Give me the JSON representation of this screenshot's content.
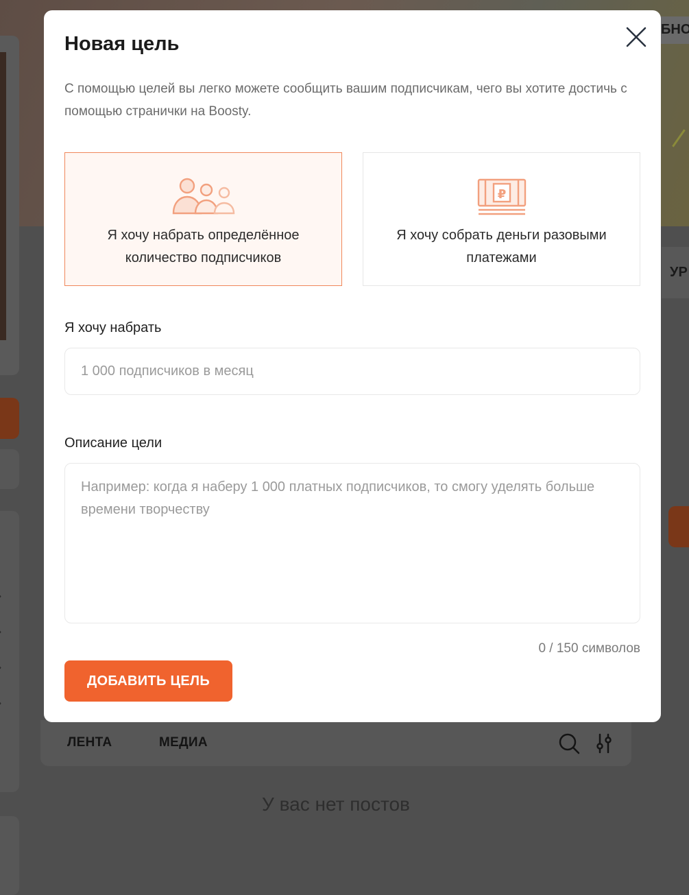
{
  "background": {
    "top_right_tab_text": "БНО",
    "right_card_text": "УР",
    "feed_tabs": [
      {
        "label": "ЛЕНТА"
      },
      {
        "label": "МЕДИА"
      }
    ],
    "empty_state": "У вас нет постов",
    "icons": [
      "search-icon",
      "filter-icon"
    ]
  },
  "modal": {
    "title": "Новая цель",
    "description": "С помощью целей вы легко можете сообщить вашим подписчикам, чего вы хотите достичь с помощью странички на Boosty.",
    "options": [
      {
        "label": "Я хочу набрать определённое количество подписчиков",
        "icon": "subscribers-icon",
        "selected": true
      },
      {
        "label": "Я хочу собрать деньги разовыми платежами",
        "icon": "money-ruble-icon",
        "selected": false
      }
    ],
    "target_field": {
      "label": "Я хочу набрать",
      "placeholder": "1 000 подписчиков в месяц",
      "value": ""
    },
    "description_field": {
      "label": "Описание цели",
      "placeholder": "Например: когда я наберу 1 000 платных подписчиков, то смогу уделять больше времени творчеству",
      "value": ""
    },
    "char_counter": "0 / 150 символов",
    "submit_label": "ДОБАВИТЬ ЦЕЛЬ",
    "accent_color": "#f0632e",
    "icon_color": "#f2a07e"
  }
}
